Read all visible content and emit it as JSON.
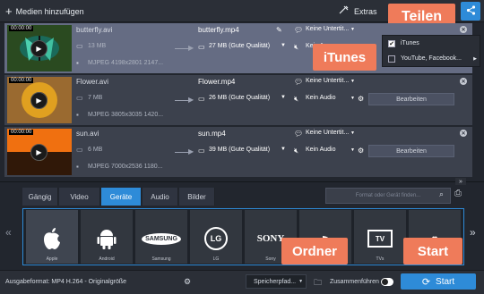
{
  "toolbar": {
    "add_media": "Medien hinzufügen",
    "extras": "Extras"
  },
  "share": {
    "callout": "Teilen",
    "itunes_callout": "iTunes",
    "options": [
      {
        "label": "iTunes",
        "checked": true
      },
      {
        "label": "YouTube, Facebook...",
        "checked": false
      }
    ]
  },
  "files": [
    {
      "timecode": "00:00:00",
      "source_name": "butterfly.avi",
      "source_size": "13 MB",
      "source_codec": "MJPEG 4198x2801 2147...",
      "output_name": "butterfly.mp4",
      "output_size": "27 MB (Gute Qualität)",
      "subtitles": "Keine Untertit...",
      "audio": "Kein A",
      "edit": "Bearbeiten",
      "selected": true
    },
    {
      "timecode": "00:00:00",
      "source_name": "Flower.avi",
      "source_size": "7 MB",
      "source_codec": "MJPEG 3805x3035 1420...",
      "output_name": "Flower.mp4",
      "output_size": "26 MB (Gute Qualität)",
      "subtitles": "Keine Untertit...",
      "audio": "Kein Audio",
      "edit": "Bearbeiten",
      "selected": false
    },
    {
      "timecode": "00:00:00",
      "source_name": "sun.avi",
      "source_size": "6 MB",
      "source_codec": "MJPEG 7000x2536 1180...",
      "output_name": "sun.mp4",
      "output_size": "39 MB (Gute Qualität)",
      "subtitles": "Keine Untertit...",
      "audio": "Kein Audio",
      "edit": "Bearbeiten",
      "selected": false
    }
  ],
  "tabs": [
    {
      "label": "Gängig",
      "active": false
    },
    {
      "label": "Video",
      "active": false
    },
    {
      "label": "Geräte",
      "active": true
    },
    {
      "label": "Audio",
      "active": false
    },
    {
      "label": "Bilder",
      "active": false
    }
  ],
  "search": {
    "placeholder": "Format oder Gerät finden..."
  },
  "devices": [
    {
      "label": "Apple",
      "logo": "apple-logo"
    },
    {
      "label": "Android",
      "logo": "android-logo"
    },
    {
      "label": "Samsung",
      "logo": "SAMSUNG"
    },
    {
      "label": "LG",
      "logo": "LG"
    },
    {
      "label": "Sony",
      "logo": "SONY"
    },
    {
      "label": "",
      "logo": "playstation-logo"
    },
    {
      "label": "TVs",
      "logo": "TV"
    },
    {
      "label": "",
      "logo": "huawei-logo"
    }
  ],
  "bottom": {
    "output_format": "Ausgabeformat: MP4 H.264 - Originalgröße",
    "save_path": "Speicherpfad...",
    "merge": "Zusammenführen",
    "start": "Start",
    "ordner_callout": "Ordner",
    "start_callout": "Start"
  },
  "colors": {
    "accent": "#2e8bd8",
    "callout": "#ef7b5a",
    "selected_row": "#656c83"
  }
}
